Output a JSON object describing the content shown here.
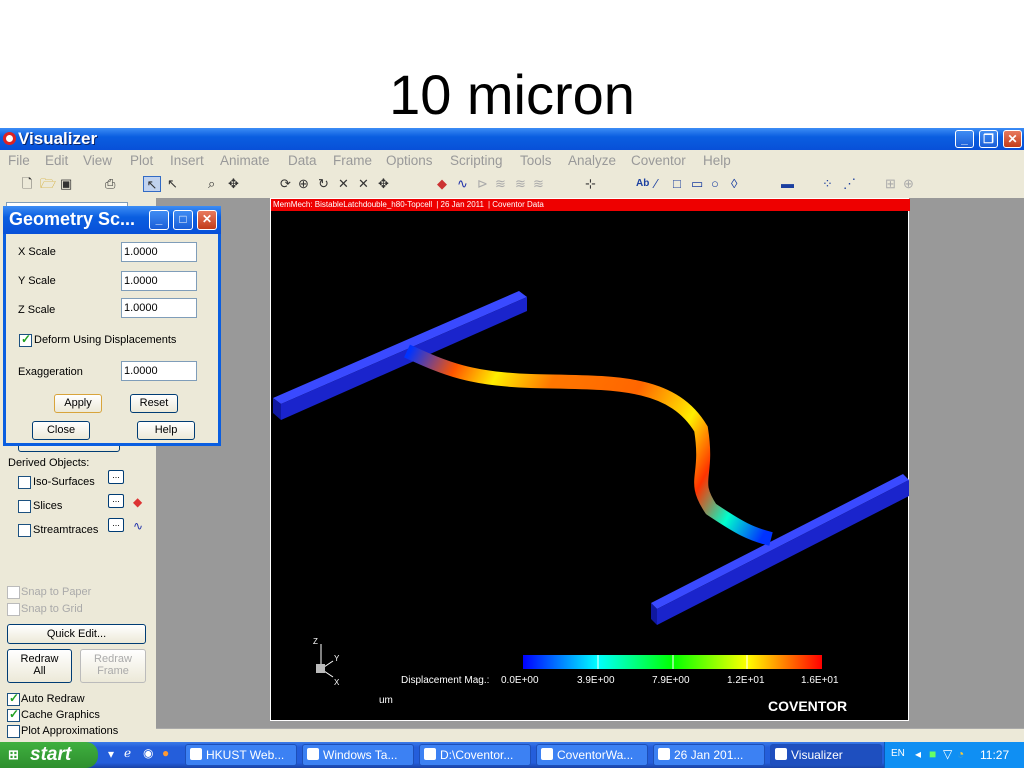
{
  "slide": {
    "title": "10 micron"
  },
  "window": {
    "title": "Visualizer",
    "minimize": "_",
    "maximize": "❐",
    "close": "✕"
  },
  "menu": [
    "File",
    "Edit",
    "View",
    "Plot",
    "Insert",
    "Animate",
    "Data",
    "Frame",
    "Options",
    "Scripting",
    "Tools",
    "Analyze",
    "Coventor",
    "Help"
  ],
  "toolbar": {
    "text_tool": "Ab"
  },
  "viewport": {
    "header": [
      "MemMech: BistableLatchdouble_h80-Topcell",
      "26 Jan 2011",
      "Coventor Data"
    ],
    "axis_labels": {
      "z": "Z",
      "y": "Y",
      "x": "X"
    },
    "legend": {
      "label": "Displacement Mag.:",
      "ticks": [
        "0.0E+00",
        "3.9E+00",
        "7.9E+00",
        "1.2E+01",
        "1.6E+01"
      ],
      "colors": [
        "#0000ff",
        "#00ffff",
        "#00ff00",
        "#ffff00",
        "#ff0000"
      ],
      "unit": "um"
    },
    "brand": "COVENTOR"
  },
  "left_panel": {
    "derived_objects_label": "Derived Objects:",
    "iso_surfaces": "Iso-Surfaces",
    "slices": "Slices",
    "streamtraces": "Streamtraces",
    "more_button": "...",
    "snap_to_paper": "Snap to Paper",
    "snap_to_grid": "Snap to Grid",
    "quick_edit": "Quick Edit...",
    "redraw_all": [
      "Redraw",
      "All"
    ],
    "redraw_frame": [
      "Redraw",
      "Frame"
    ],
    "auto_redraw": "Auto Redraw",
    "cache_graphics": "Cache Graphics",
    "plot_approximations": "Plot Approximations"
  },
  "geometry_dialog": {
    "title": "Geometry Sc...",
    "x_scale_label": "X Scale",
    "x_scale_value": "1.0000",
    "y_scale_label": "Y Scale",
    "y_scale_value": "1.0000",
    "z_scale_label": "Z Scale",
    "z_scale_value": "1.0000",
    "deform_label": "Deform Using Displacements",
    "deform_checked": true,
    "exaggeration_label": "Exaggeration",
    "exaggeration_value": "1.0000",
    "apply": "Apply",
    "reset": "Reset",
    "close": "Close",
    "help": "Help"
  },
  "taskbar": {
    "start": "start",
    "tasks": [
      "HKUST Web...",
      "Windows Ta...",
      "D:\\Coventor...",
      "CoventorWa...",
      "26 Jan 201...",
      "Visualizer"
    ],
    "language": "EN",
    "clock": "11:27"
  }
}
